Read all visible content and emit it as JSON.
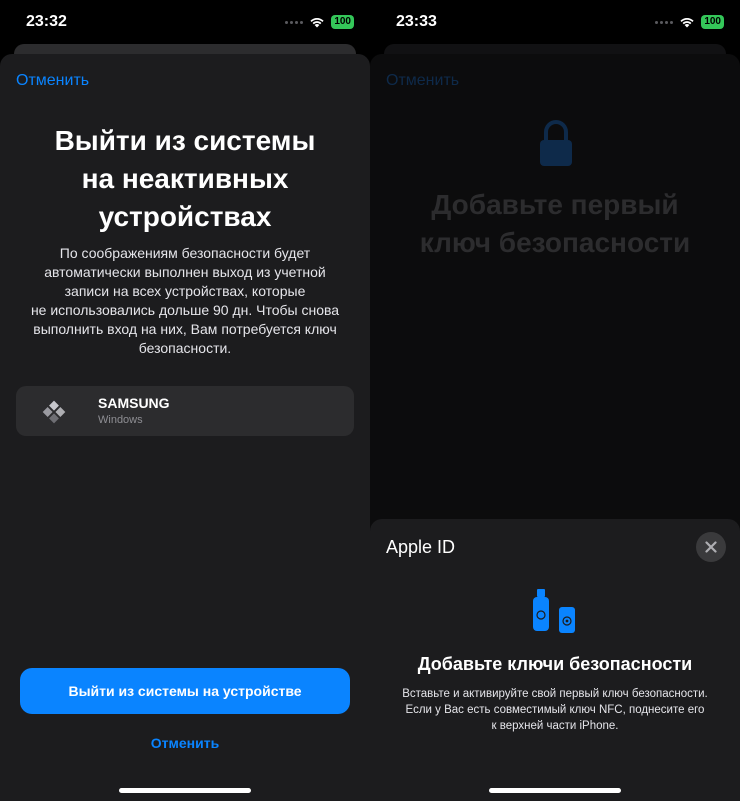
{
  "left": {
    "status": {
      "time": "23:32",
      "battery": "100"
    },
    "cancel_top": "Отменить",
    "title_lines": [
      "Выйти из системы",
      "на неактивных",
      "устройствах"
    ],
    "description_lines": [
      "По соображениям безопасности будет",
      "автоматически выполнен выход из учетной",
      "записи на всех устройствах, которые",
      "не использовались дольше 90 дн. Чтобы снова",
      "выполнить вход на них, Вам потребуется ключ",
      "безопасности."
    ],
    "device": {
      "name": "SAMSUNG",
      "os": "Windows",
      "icon": "windows-device-icon"
    },
    "primary_button": "Выйти из системы на устройстве",
    "cancel_bottom": "Отменить"
  },
  "right": {
    "status": {
      "time": "23:33",
      "battery": "100"
    },
    "cancel_dim": "Отменить",
    "title_lines": [
      "Добавьте первый",
      "ключ безопасности"
    ],
    "modal": {
      "title": "Apple ID",
      "close_icon": "close-icon",
      "heading": "Добавьте ключи безопасности",
      "body_lines": [
        "Вставьте и активируйте свой первый ключ безопасности.",
        "Если у Вас есть совместимый ключ NFC, поднесите его",
        "к верхней части iPhone."
      ]
    }
  },
  "colors": {
    "accent": "#0a84ff",
    "battery": "#34c759",
    "sheet": "#1c1c1e"
  }
}
